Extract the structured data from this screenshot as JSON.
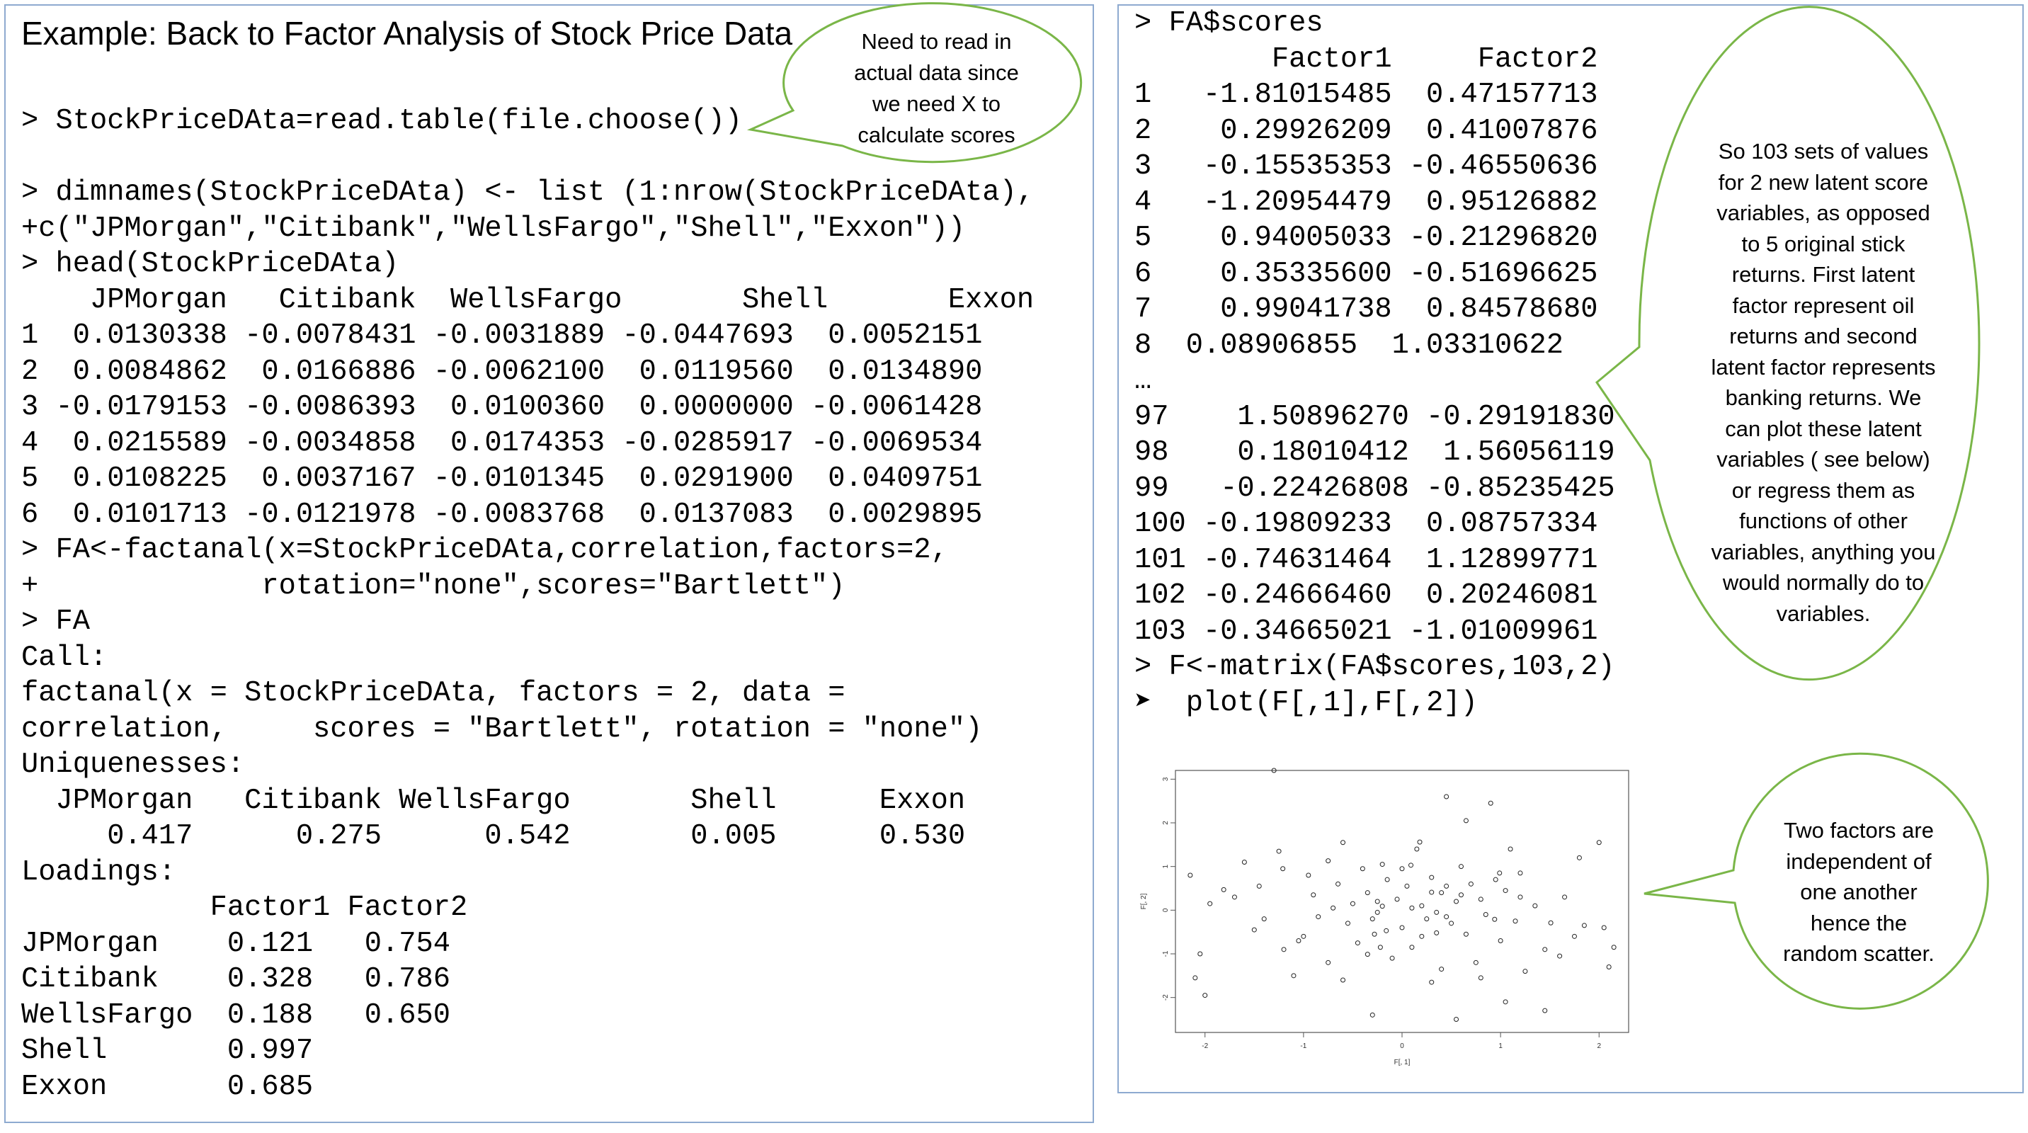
{
  "slide": {
    "title": "Example: Back to Factor Analysis of Stock Price Data"
  },
  "left_code": {
    "lines": [
      "> StockPriceDAta=read.table(file.choose())",
      "",
      "> dimnames(StockPriceDAta) <- list (1:nrow(StockPriceDAta),",
      "+c(\"JPMorgan\",\"Citibank\",\"WellsFargo\",\"Shell\",\"Exxon\"))",
      "> head(StockPriceDAta)",
      "    JPMorgan   Citibank  WellsFargo       Shell       Exxon",
      "1  0.0130338 -0.0078431 -0.0031889 -0.0447693  0.0052151",
      "2  0.0084862  0.0166886 -0.0062100  0.0119560  0.0134890",
      "3 -0.0179153 -0.0086393  0.0100360  0.0000000 -0.0061428",
      "4  0.0215589 -0.0034858  0.0174353 -0.0285917 -0.0069534",
      "5  0.0108225  0.0037167 -0.0101345  0.0291900  0.0409751",
      "6  0.0101713 -0.0121978 -0.0083768  0.0137083  0.0029895",
      "> FA<-factanal(x=StockPriceDAta,correlation,factors=2,",
      "+             rotation=\"none\",scores=\"Bartlett\")",
      "> FA",
      "Call:",
      "factanal(x = StockPriceDAta, factors = 2, data =",
      "correlation,     scores = \"Bartlett\", rotation = \"none\")",
      "Uniquenesses:",
      "  JPMorgan   Citibank WellsFargo       Shell      Exxon",
      "     0.417      0.275      0.542       0.005      0.530",
      "Loadings:",
      "           Factor1 Factor2",
      "JPMorgan    0.121   0.754",
      "Citibank    0.328   0.786",
      "WellsFargo  0.188   0.650",
      "Shell       0.997",
      "Exxon       0.685"
    ]
  },
  "right_code": {
    "command": "> FA$scores",
    "header": "        Factor1     Factor2",
    "rows": [
      "1   -1.81015485  0.47157713",
      "2    0.29926209  0.41007876",
      "3   -0.15535353 -0.46550636",
      "4   -1.20954479  0.95126882",
      "5    0.94005033 -0.21296820",
      "6    0.35335600 -0.51696625",
      "7    0.99041738  0.84578680",
      "8  0.08906855  1.03310622",
      "…",
      "97    1.50896270 -0.29191830",
      "98    0.18010412  1.56056119",
      "99   -0.22426808 -0.85235425",
      "100 -0.19809233  0.08757334",
      "101 -0.74631464  1.12899771",
      "102 -0.24666460  0.20246081",
      "103 -0.34665021 -1.01009961",
      "> F<-matrix(FA$scores,103,2)",
      "➤  plot(F[,1],F[,2])"
    ]
  },
  "callouts": {
    "read_data": "Need to read in actual data since we need X to calculate scores",
    "latent": "So 103 sets of values for 2 new latent score variables, as opposed to 5 original stick returns. First latent factor represent oil returns and second latent factor represents banking returns. We can plot these latent variables ( see below) or regress them as functions of other variables, anything you would normally do to variables.",
    "independent": "Two factors are independent of one another hence the random scatter."
  },
  "colors": {
    "callout_border": "#7ab648",
    "panel_border": "#8eaad0"
  },
  "chart_data": {
    "type": "scatter",
    "xlabel": "F[, 1]",
    "ylabel": "F[, 2]",
    "xlim": [
      -2.3,
      2.3
    ],
    "ylim": [
      -2.8,
      3.2
    ],
    "xticks": [
      "-2",
      "-1",
      "0",
      "1",
      "2"
    ],
    "yticks": [
      "-2",
      "-1",
      "0",
      "1",
      "2",
      "3"
    ],
    "points": [
      [
        -1.81,
        0.47
      ],
      [
        0.3,
        0.41
      ],
      [
        -0.16,
        -0.47
      ],
      [
        -1.21,
        0.95
      ],
      [
        0.94,
        -0.21
      ],
      [
        0.35,
        -0.52
      ],
      [
        0.99,
        0.85
      ],
      [
        0.09,
        1.03
      ],
      [
        1.51,
        -0.29
      ],
      [
        0.18,
        1.56
      ],
      [
        -0.22,
        -0.85
      ],
      [
        -0.2,
        0.09
      ],
      [
        -0.75,
        1.13
      ],
      [
        -0.25,
        0.2
      ],
      [
        -0.35,
        -1.01
      ],
      [
        -1.3,
        3.2
      ],
      [
        0.45,
        2.6
      ],
      [
        0.9,
        2.45
      ],
      [
        -0.6,
        1.55
      ],
      [
        0.65,
        2.05
      ],
      [
        2.0,
        1.55
      ],
      [
        1.8,
        1.2
      ],
      [
        -2.15,
        0.8
      ],
      [
        -2.05,
        -1.0
      ],
      [
        -2.0,
        -1.95
      ],
      [
        -1.95,
        0.15
      ],
      [
        -1.6,
        1.1
      ],
      [
        -1.5,
        -0.45
      ],
      [
        -1.45,
        0.55
      ],
      [
        -1.25,
        1.35
      ],
      [
        -1.2,
        -0.9
      ],
      [
        -1.1,
        -1.5
      ],
      [
        -1.05,
        -0.7
      ],
      [
        -0.95,
        0.8
      ],
      [
        -0.9,
        0.35
      ],
      [
        -0.85,
        -0.15
      ],
      [
        -0.75,
        -1.2
      ],
      [
        -0.65,
        0.6
      ],
      [
        -0.55,
        -0.3
      ],
      [
        -0.5,
        0.15
      ],
      [
        -0.45,
        -0.75
      ],
      [
        -0.4,
        0.95
      ],
      [
        -0.35,
        0.4
      ],
      [
        -0.3,
        -0.2
      ],
      [
        -0.28,
        -0.55
      ],
      [
        -0.15,
        0.7
      ],
      [
        -0.1,
        -1.1
      ],
      [
        -0.05,
        0.25
      ],
      [
        0.0,
        -0.4
      ],
      [
        0.05,
        0.55
      ],
      [
        0.1,
        -0.85
      ],
      [
        0.15,
        1.4
      ],
      [
        0.2,
        0.1
      ],
      [
        0.25,
        -0.2
      ],
      [
        0.3,
        0.75
      ],
      [
        0.35,
        -0.05
      ],
      [
        0.4,
        0.4
      ],
      [
        0.45,
        0.55
      ],
      [
        0.5,
        -0.3
      ],
      [
        0.55,
        0.2
      ],
      [
        0.6,
        1.0
      ],
      [
        0.65,
        -0.55
      ],
      [
        0.7,
        0.6
      ],
      [
        0.75,
        -1.2
      ],
      [
        0.8,
        0.25
      ],
      [
        0.85,
        -0.1
      ],
      [
        0.95,
        0.7
      ],
      [
        1.0,
        -0.7
      ],
      [
        1.05,
        0.45
      ],
      [
        1.1,
        1.4
      ],
      [
        1.15,
        -0.25
      ],
      [
        1.2,
        0.85
      ],
      [
        1.25,
        -1.4
      ],
      [
        1.35,
        0.1
      ],
      [
        1.45,
        -0.9
      ],
      [
        1.6,
        -1.05
      ],
      [
        1.65,
        0.3
      ],
      [
        1.75,
        -0.6
      ],
      [
        1.85,
        -0.35
      ],
      [
        2.05,
        -0.4
      ],
      [
        2.1,
        -1.3
      ],
      [
        2.15,
        -0.85
      ],
      [
        -2.1,
        -1.55
      ],
      [
        -1.7,
        0.3
      ],
      [
        -1.0,
        -0.6
      ],
      [
        -0.2,
        1.05
      ],
      [
        0.4,
        -1.35
      ],
      [
        0.55,
        -2.5
      ],
      [
        1.05,
        -2.1
      ],
      [
        1.45,
        -2.3
      ],
      [
        -0.3,
        -2.4
      ],
      [
        -0.6,
        -1.6
      ],
      [
        0.2,
        -0.6
      ],
      [
        0.6,
        0.35
      ],
      [
        -0.7,
        0.05
      ],
      [
        0.0,
        0.95
      ],
      [
        0.3,
        -1.65
      ],
      [
        0.8,
        -1.55
      ],
      [
        -1.4,
        -0.2
      ],
      [
        1.2,
        0.3
      ],
      [
        0.45,
        -0.15
      ],
      [
        -0.25,
        -0.05
      ],
      [
        0.1,
        0.05
      ]
    ]
  }
}
